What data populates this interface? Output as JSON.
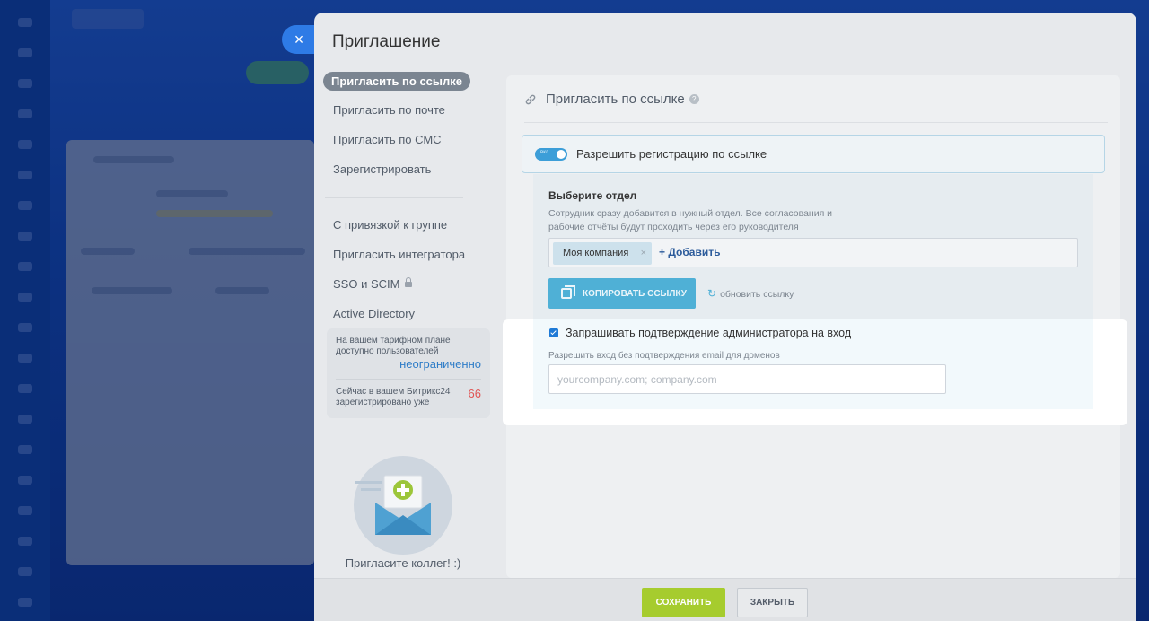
{
  "dialog": {
    "title": "Приглашение",
    "close_icon": "×"
  },
  "nav": {
    "items": [
      {
        "label": "Пригласить по ссылке",
        "active": true
      },
      {
        "label": "Пригласить по почте"
      },
      {
        "label": "Пригласить по СМС"
      },
      {
        "label": "Зарегистрировать"
      },
      {
        "label": "С привязкой к группе"
      },
      {
        "label": "Пригласить интегратора"
      },
      {
        "label": "SSO и SCIM",
        "icon": "lock-icon"
      },
      {
        "label": "Active Directory"
      }
    ]
  },
  "plan": {
    "available_label": "На вашем тарифном плане доступно пользователей",
    "available_value": "неограниченно",
    "registered_label": "Сейчас в вашем Битрикс24 зарегистрировано уже",
    "registered_value": "66"
  },
  "illustration": {
    "caption": "Пригласите коллег! :)"
  },
  "card": {
    "title": "Пригласить по ссылке",
    "title_icon": "link-icon",
    "help_icon": "?",
    "toggle": {
      "state_text": "вкл",
      "label": "Разрешить регистрацию по ссылке",
      "on": true
    },
    "department": {
      "title": "Выберите отдел",
      "description": "Сотрудник сразу добавится в нужный отдел. Все согласования и рабочие отчёты будут проходить через его руководителя",
      "chip": "Моя компания",
      "chip_remove": "×",
      "add_label": "+ Добавить"
    },
    "copy_button": "КОПИРОВАТЬ ССЫЛКУ",
    "refresh_link": "обновить ссылку",
    "admin_confirm": {
      "label": "Запрашивать подтверждение администратора на вход",
      "checked": true
    },
    "domains": {
      "label": "Разрешить вход без подтверждения email для доменов",
      "placeholder": "yourcompany.com; company.com",
      "value": ""
    }
  },
  "footer": {
    "save": "СОХРАНИТЬ",
    "close": "ЗАКРЫТЬ"
  },
  "colors": {
    "accent": "#2e7be6",
    "save_green": "#a6cc2e",
    "copy_blue": "#4fb0d6",
    "value_red": "#e05555"
  }
}
